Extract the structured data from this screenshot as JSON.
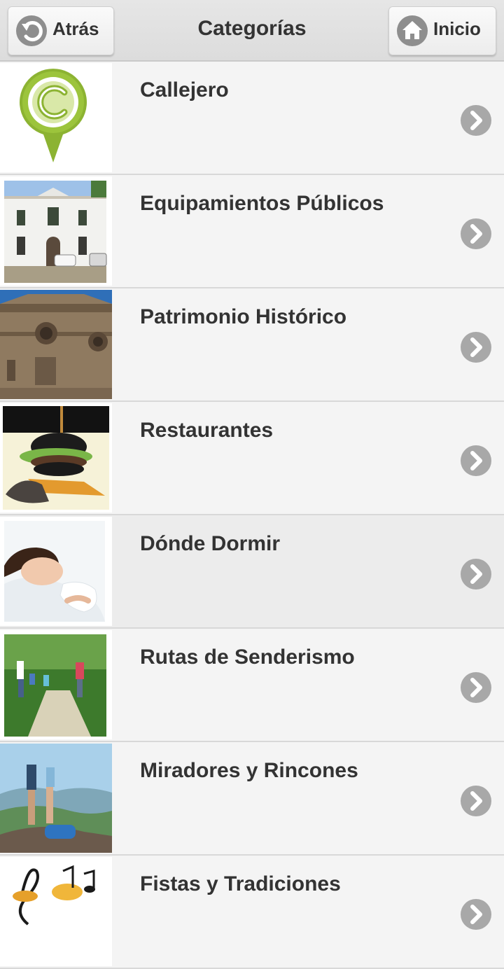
{
  "header": {
    "title": "Categorías",
    "back_label": "Atrás",
    "home_label": "Inicio"
  },
  "categories": [
    {
      "label": "Callejero",
      "thumb": "map-pin-logo"
    },
    {
      "label": "Equipamientos Públicos",
      "thumb": "town-hall-photo"
    },
    {
      "label": "Patrimonio Histórico",
      "thumb": "church-tower-photo"
    },
    {
      "label": "Restaurantes",
      "thumb": "burger-dish-photo"
    },
    {
      "label": "Dónde Dormir",
      "thumb": "sleeping-woman-photo"
    },
    {
      "label": "Rutas de Senderismo",
      "thumb": "hiking-family-photo"
    },
    {
      "label": "Miradores y Rincones",
      "thumb": "viewpoint-hikers-photo"
    },
    {
      "label": "Fistas y Tradiciones",
      "thumb": "music-notes-image"
    }
  ],
  "colors": {
    "header_bg": "#dcdcdc",
    "list_bg": "#f4f4f4",
    "active_row_bg": "#ececec",
    "text": "#333333",
    "icon_gray": "#a8a8a8",
    "logo_green": "#8cb332"
  }
}
